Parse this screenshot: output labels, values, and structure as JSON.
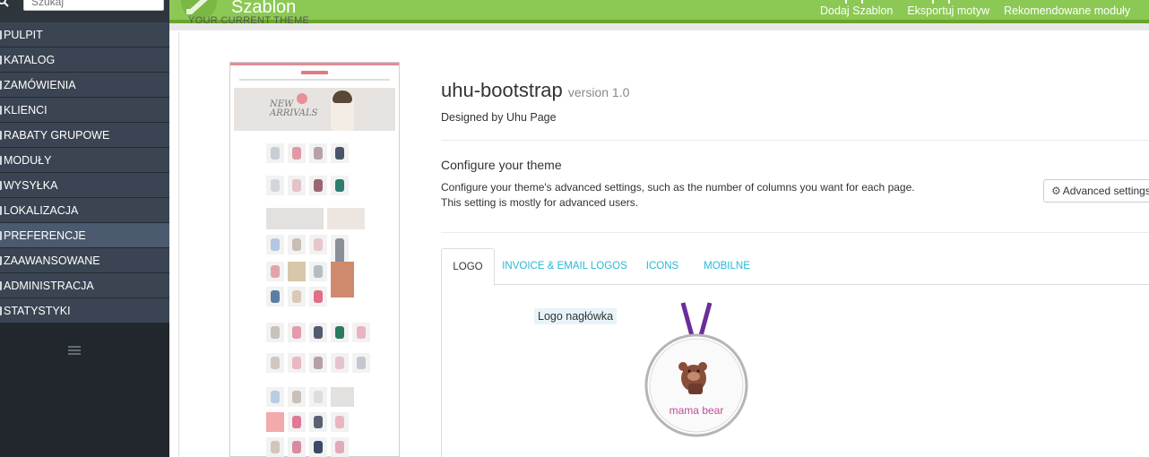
{
  "search": {
    "placeholder": "Szukaj"
  },
  "sidebar": {
    "items": [
      {
        "label": "PULPIT"
      },
      {
        "label": "KATALOG"
      },
      {
        "label": "ZAMÓWIENIA"
      },
      {
        "label": "KLIENCI"
      },
      {
        "label": "RABATY GRUPOWE"
      },
      {
        "label": "MODUŁY"
      },
      {
        "label": "WYSYŁKA"
      },
      {
        "label": "LOKALIZACJA"
      },
      {
        "label": "PREFERENCJE",
        "active": true
      },
      {
        "label": "ZAAWANSOWANE"
      },
      {
        "label": "ADMINISTRACJA"
      },
      {
        "label": "STATYSTYKI"
      }
    ]
  },
  "header": {
    "title": "Szablon",
    "section_heading": "YOUR CURRENT THEME",
    "actions": [
      {
        "label": "Dodaj Szablon"
      },
      {
        "label": "Eksportuj motyw"
      },
      {
        "label": "Rekomendowane moduły"
      }
    ]
  },
  "theme": {
    "name": "uhu-bootstrap",
    "version": "version 1.0",
    "designed_by": "Designed by Uhu Page",
    "preview_banner": "NEW ARRIVALS"
  },
  "configure": {
    "title": "Configure your theme",
    "description": "Configure your theme's advanced settings, such as the number of columns you want for each page. This setting is mostly for advanced users.",
    "button_label": "Advanced settings"
  },
  "tabs": [
    {
      "label": "LOGO",
      "active": true
    },
    {
      "label": "INVOICE & EMAIL LOGOS"
    },
    {
      "label": "ICONS"
    },
    {
      "label": "MOBILNE"
    }
  ],
  "logo": {
    "label": "Logo nagłówka",
    "brand_text": "mama bear"
  },
  "colors": {
    "accent_green": "#8bc954",
    "sidebar_bg": "#3b4452",
    "tab_link": "#25b9d7"
  }
}
